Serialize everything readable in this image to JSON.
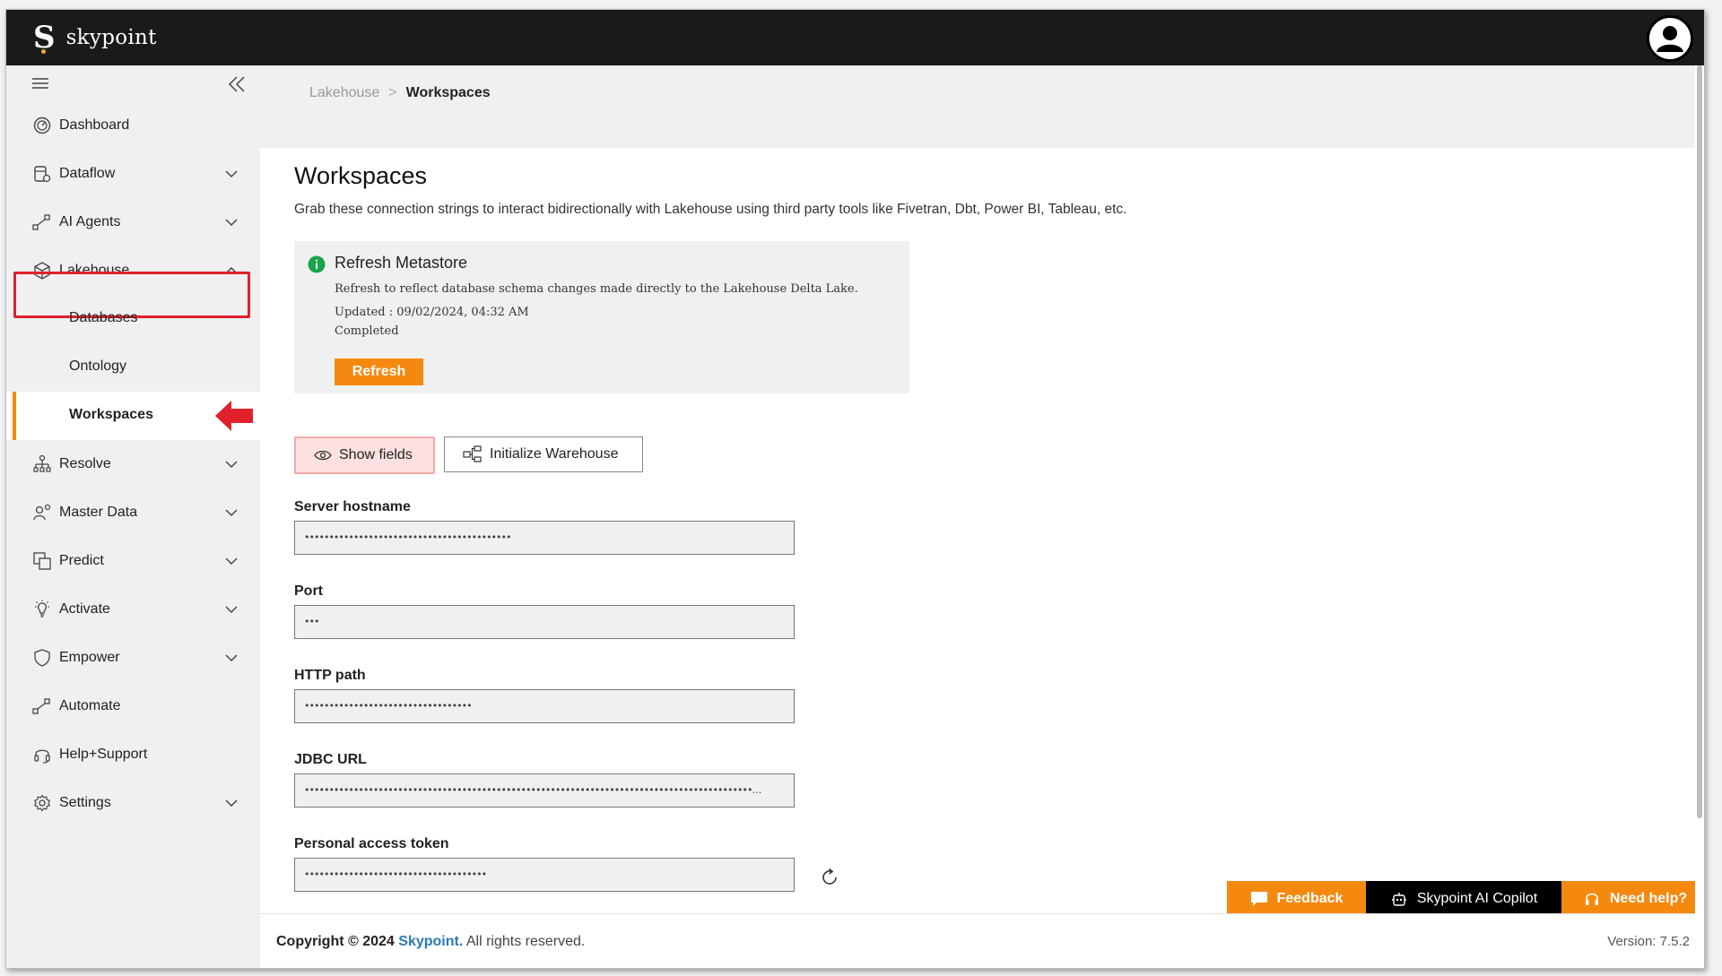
{
  "app": {
    "brand_letter": "S",
    "brand_name": "skypoint"
  },
  "breadcrumb": {
    "parent": "Lakehouse",
    "separator": ">",
    "current": "Workspaces"
  },
  "sidebar": {
    "items": [
      {
        "label": "Dashboard",
        "icon": "dashboard-icon"
      },
      {
        "label": "Dataflow",
        "icon": "dataflow-icon"
      },
      {
        "label": "AI Agents",
        "icon": "ai-agents-icon"
      },
      {
        "label": "Lakehouse",
        "icon": "cube-icon"
      },
      {
        "label": "Databases"
      },
      {
        "label": "Ontology"
      },
      {
        "label": "Workspaces"
      },
      {
        "label": "Resolve",
        "icon": "resolve-icon"
      },
      {
        "label": "Master Data",
        "icon": "master-data-icon"
      },
      {
        "label": "Predict",
        "icon": "predict-icon"
      },
      {
        "label": "Activate",
        "icon": "bulb-icon"
      },
      {
        "label": "Empower",
        "icon": "shield-icon"
      },
      {
        "label": "Automate",
        "icon": "automate-icon"
      },
      {
        "label": "Help+Support",
        "icon": "headset-icon"
      },
      {
        "label": "Settings",
        "icon": "gear-icon"
      }
    ]
  },
  "page": {
    "title": "Workspaces",
    "description": "Grab these connection strings to interact bidirectionally with Lakehouse using third party tools like Fivetran, Dbt, Power BI, Tableau, etc."
  },
  "metastore": {
    "title": "Refresh Metastore",
    "text": "Refresh to reflect database schema changes made directly to the Lakehouse Delta Lake.",
    "updated": "Updated : 09/02/2024, 04:32 AM",
    "status": "Completed",
    "button": "Refresh"
  },
  "actions": {
    "show_fields": "Show fields",
    "initialize_warehouse": "Initialize Warehouse"
  },
  "fields": {
    "server_hostname": {
      "label": "Server hostname",
      "value": "••••••••••••••••••••••••••••••••••••••••••"
    },
    "port": {
      "label": "Port",
      "value": "•••"
    },
    "http_path": {
      "label": "HTTP path",
      "value": "••••••••••••••••••••••••••••••••••"
    },
    "jdbc_url": {
      "label": "JDBC URL",
      "value": "•••••••••••••••••••••••••••••••••••••••••••••••••••••••••••••••••••••••••••••••••••••••••••…"
    },
    "token": {
      "label": "Personal access token",
      "value": "•••••••••••••••••••••••••••••••••••••"
    }
  },
  "bottom_buttons": {
    "feedback": "Feedback",
    "copilot": "Skypoint AI Copilot",
    "help": "Need help?"
  },
  "footer": {
    "copyright_prefix": "Copyright © 2024 ",
    "brand": "Skypoint.",
    "suffix": " All rights reserved.",
    "version": "Version: 7.5.2"
  },
  "colors": {
    "accent": "#f5890f",
    "topbar": "#1a1a1a",
    "highlight": "#e0202a",
    "link": "#2a7ab8",
    "success": "#1aa34a"
  }
}
